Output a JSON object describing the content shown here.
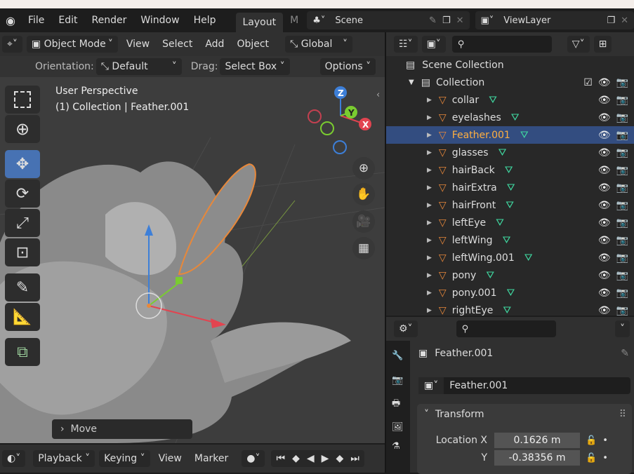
{
  "menubar": {
    "items": [
      "File",
      "Edit",
      "Render",
      "Window",
      "Help"
    ],
    "workspace_tab": "Layout",
    "next_tab": "M",
    "scene": "Scene",
    "view_layer": "ViewLayer"
  },
  "viewport_header": {
    "mode": "Object Mode",
    "menus": [
      "View",
      "Select",
      "Add",
      "Object"
    ],
    "transform_orientation": "Global",
    "orientation_label": "Orientation:",
    "orientation_value": "Default",
    "drag_label": "Drag:",
    "drag_value": "Select Box",
    "options": "Options"
  },
  "viewport": {
    "perspective": "User Perspective",
    "collection_info": "(1) Collection | Feather.001",
    "gizmo_axes": [
      "X",
      "Y",
      "Z"
    ],
    "last_operator": "Move"
  },
  "tools": [
    "select-box",
    "cursor",
    "move",
    "rotate",
    "scale",
    "transform",
    "annotate",
    "measure",
    "add-cube"
  ],
  "outliner": {
    "scene_collection": "Scene Collection",
    "collection": "Collection",
    "items": [
      {
        "name": "collar",
        "selected": false
      },
      {
        "name": "eyelashes",
        "selected": false
      },
      {
        "name": "Feather.001",
        "selected": true
      },
      {
        "name": "glasses",
        "selected": false
      },
      {
        "name": "hairBack",
        "selected": false
      },
      {
        "name": "hairExtra",
        "selected": false
      },
      {
        "name": "hairFront",
        "selected": false
      },
      {
        "name": "leftEye",
        "selected": false
      },
      {
        "name": "leftWing",
        "selected": false
      },
      {
        "name": "leftWing.001",
        "selected": false
      },
      {
        "name": "pony",
        "selected": false
      },
      {
        "name": "pony.001",
        "selected": false
      },
      {
        "name": "rightEye",
        "selected": false
      }
    ]
  },
  "properties": {
    "object_name": "Feather.001",
    "datablock": "Feather.001",
    "panel": "Transform",
    "location": [
      {
        "label": "Location X",
        "value": "0.1626 m"
      },
      {
        "label": "Y",
        "value": "-0.38356 m"
      }
    ]
  },
  "timeline": {
    "playback": "Playback",
    "keying": "Keying",
    "view": "View",
    "marker": "Marker"
  },
  "colors": {
    "accent": "#4772b3",
    "selected_row": "#334d80",
    "object_orange": "#e8883a",
    "mesh_green": "#3fd8a0"
  }
}
